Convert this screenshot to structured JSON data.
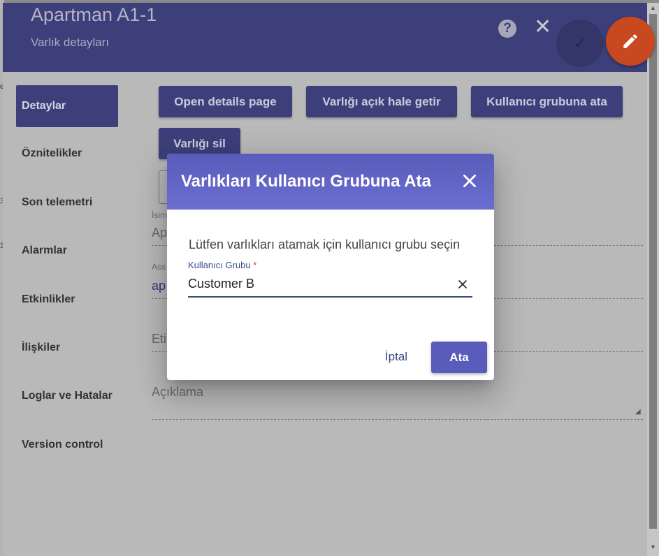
{
  "background": {
    "left_edge_chars": [
      "e",
      "3",
      "3"
    ]
  },
  "header": {
    "title": "Apartman A1-1",
    "subtitle": "Varlık detayları",
    "help_glyph": "?",
    "close_glyph": "✕",
    "save_glyph": "✓"
  },
  "nav": {
    "items": [
      {
        "label": "Detaylar",
        "active": true
      },
      {
        "label": "Öznitelikler"
      },
      {
        "label": "Son telemetri"
      },
      {
        "label": "Alarmlar"
      },
      {
        "label": "Etkinlikler"
      },
      {
        "label": "İlişkiler"
      },
      {
        "label": "Loglar ve Hatalar"
      },
      {
        "label": "Version control"
      }
    ]
  },
  "actions": {
    "open_details": "Open details page",
    "make_public": "Varlığı açık hale getir",
    "assign_group": "Kullanıcı grubuna ata",
    "delete": "Varlığı sil"
  },
  "form": {
    "name_label": "İsim",
    "name_value": "Ap",
    "asset_profile_label": "Ass",
    "asset_profile_value": "ap",
    "label_value": "Eti",
    "description_placeholder": "Açıklama"
  },
  "dialog": {
    "title": "Varlıkları Kullanıcı Grubuna Ata",
    "prompt": "Lütfen varlıkları atamak için kullanıcı grubu seçin",
    "select_label": "Kullanıcı Grubu",
    "required_mark": "*",
    "select_value": "Customer B",
    "cancel_label": "İptal",
    "assign_label": "Ata"
  },
  "icons": {
    "help": "help-circle-icon",
    "close": "close-icon",
    "save": "check-icon",
    "edit": "pencil-icon",
    "clear": "clear-icon"
  },
  "colors": {
    "primary": "#5a5cbb",
    "accent": "#e4572e"
  }
}
